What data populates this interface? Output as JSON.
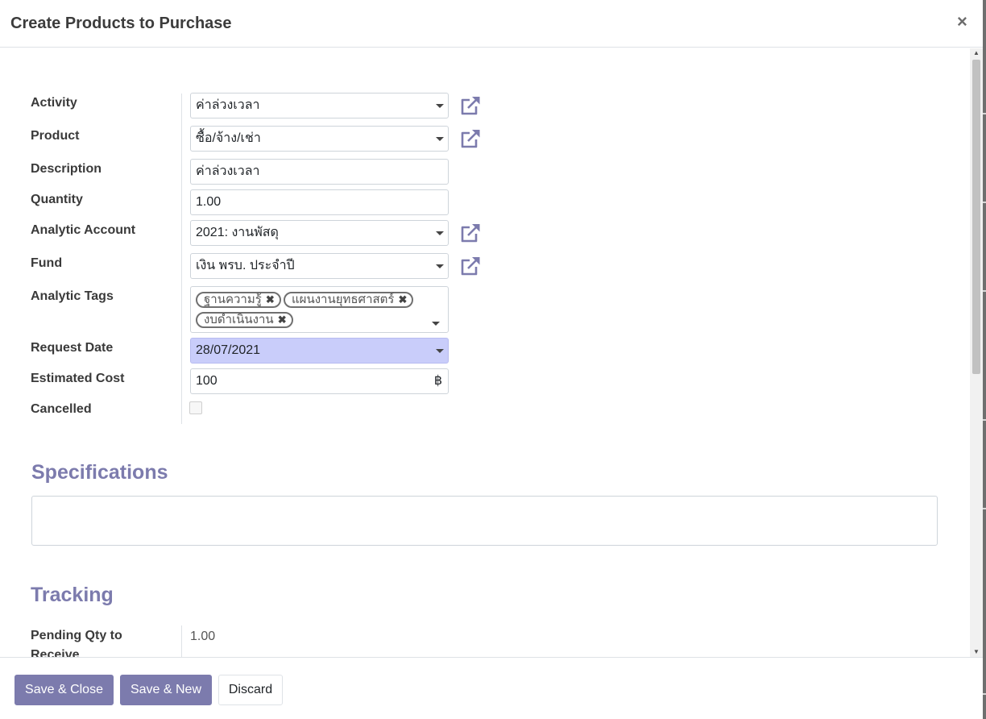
{
  "dialog": {
    "title": "Create Products to Purchase",
    "close_symbol": "×"
  },
  "form": {
    "activity": {
      "label": "Activity",
      "value": "ค่าล่วงเวลา"
    },
    "product": {
      "label": "Product",
      "value": "ซื้อ/จ้าง/เช่า"
    },
    "description": {
      "label": "Description",
      "value": "ค่าล่วงเวลา"
    },
    "quantity": {
      "label": "Quantity",
      "value": "1.00"
    },
    "analytic_account": {
      "label": "Analytic Account",
      "value": "2021: งานพัสดุ"
    },
    "fund": {
      "label": "Fund",
      "value": "เงิน พรบ. ประจำปี"
    },
    "analytic_tags": {
      "label": "Analytic Tags",
      "tags": [
        "ฐานความรู้",
        "แผนงานยุทธศาสตร์",
        "งบดำเนินงาน"
      ]
    },
    "request_date": {
      "label": "Request Date",
      "value": "28/07/2021"
    },
    "estimated_cost": {
      "label": "Estimated Cost",
      "value": "100",
      "currency": "฿"
    },
    "cancelled": {
      "label": "Cancelled",
      "checked": false
    }
  },
  "specifications": {
    "title": "Specifications",
    "value": ""
  },
  "tracking": {
    "title": "Tracking",
    "pending_qty_label_1": "Pending Qty to",
    "pending_qty_label_2": "Receive",
    "pending_qty_value": "1.00"
  },
  "footer": {
    "save_close": "Save & Close",
    "save_new": "Save & New",
    "discard": "Discard"
  },
  "colors": {
    "primary": "#7c7bad",
    "date_highlight": "#c9cdfa"
  },
  "icons": {
    "external_link": "external-link-icon",
    "dropdown": "caret-down-icon",
    "tag_remove": "close-icon"
  }
}
